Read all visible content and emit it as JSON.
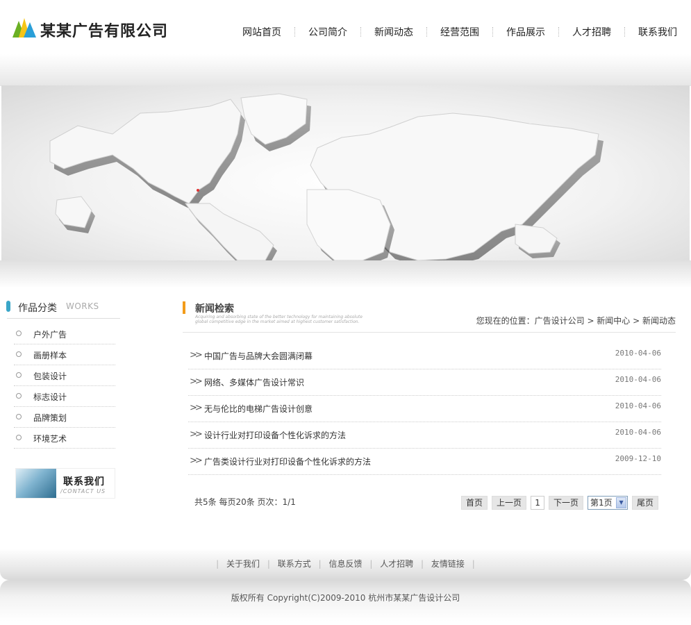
{
  "header": {
    "company_name": "某某广告有限公司",
    "nav": [
      "网站首页",
      "公司简介",
      "新闻动态",
      "经营范围",
      "作品展示",
      "人才招聘",
      "联系我们"
    ]
  },
  "sidebar": {
    "title": "作品分类",
    "subtitle": "WORKS",
    "items": [
      "户外广告",
      "画册样本",
      "包装设计",
      "标志设计",
      "品牌策划",
      "环境艺术"
    ],
    "contact": {
      "title": "联系我们",
      "subtitle": "/CONTACT US"
    }
  },
  "main": {
    "title": "新闻检索",
    "description": "Acquiring and absorbing state of the better technology for maintaining absolute global competitive edge in the market aimed at highest customer satisfaction.",
    "breadcrumb": "您现在的位置：广告设计公司  > 新闻中心  > 新闻动态",
    "news": [
      {
        "title": "中国广告与品牌大会圆满闭幕",
        "date": "2010-04-06"
      },
      {
        "title": "网络、多媒体广告设计常识",
        "date": "2010-04-06"
      },
      {
        "title": "无与伦比的电梯广告设计创意",
        "date": "2010-04-06"
      },
      {
        "title": "设计行业对打印设备个性化诉求的方法",
        "date": "2010-04-06"
      },
      {
        "title": "广告类设计行业对打印设备个性化诉求的方法",
        "date": "2009-12-10"
      }
    ],
    "pager": {
      "info": "共5条  每页20条  页次：1/1",
      "first": "首页",
      "prev": "上一页",
      "current": "1",
      "next": "下一页",
      "select": "第1页",
      "last": "尾页"
    }
  },
  "footer": {
    "links": [
      "关于我们",
      "联系方式",
      "信息反馈",
      "人才招聘",
      "友情链接"
    ],
    "copyright": "版权所有  Copyright(C)2009-2010 杭州市某某广告设计公司"
  },
  "colors": {
    "accent_orange": "#f39c1a",
    "accent_blue": "#3aa6c8",
    "logo_green": "#6ab023",
    "logo_yellow": "#f5c518",
    "logo_blue": "#2a9fd8"
  }
}
